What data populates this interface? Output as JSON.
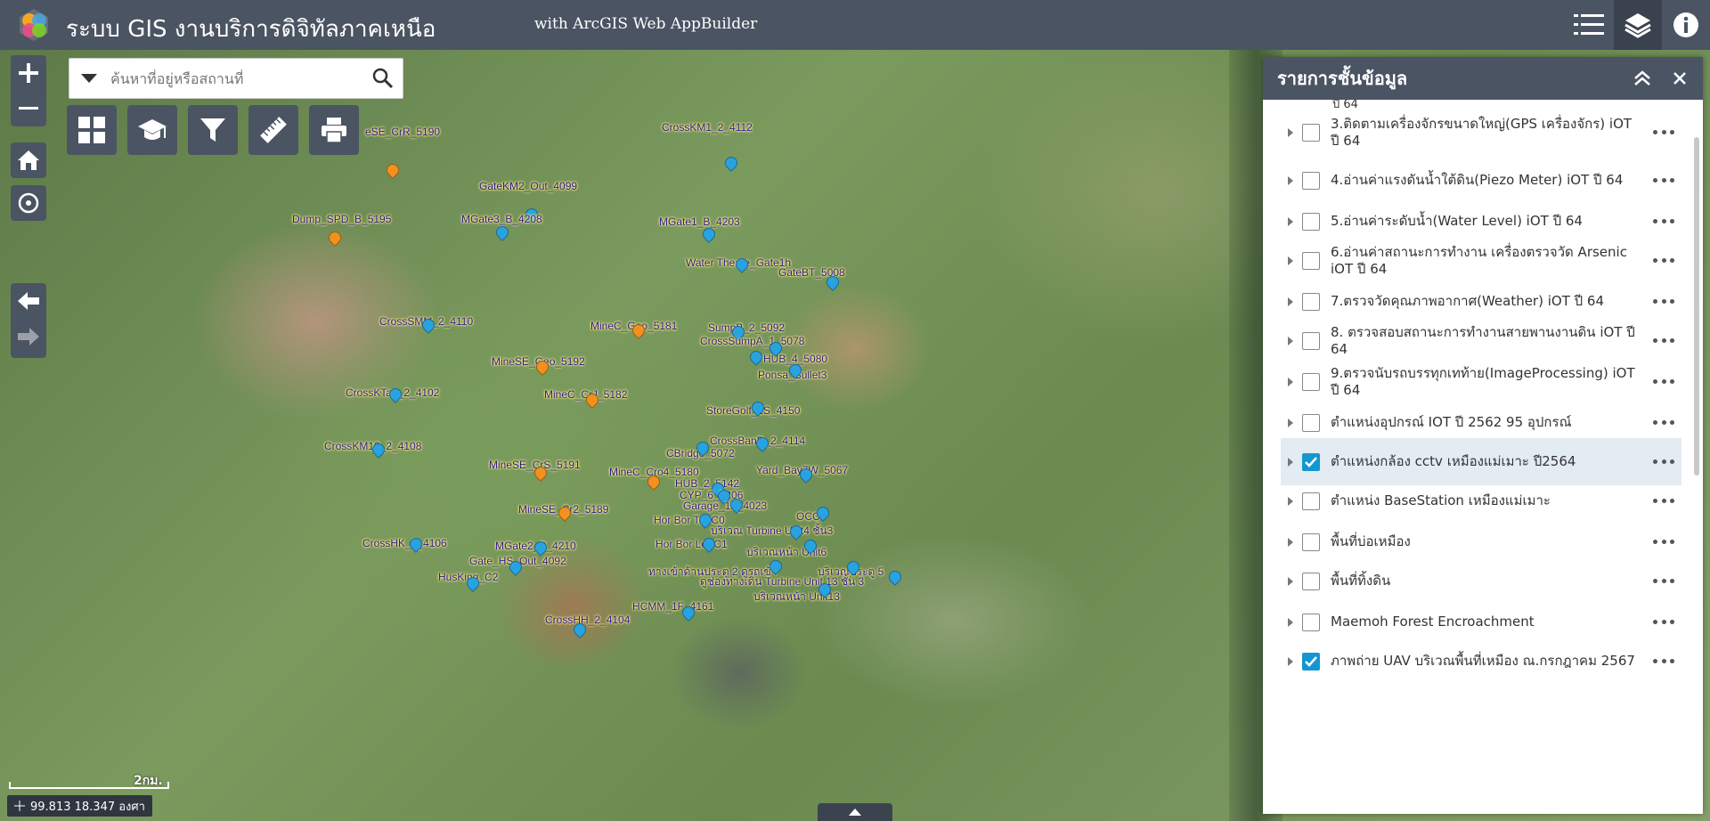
{
  "header": {
    "title": "ระบบ GIS งานบริการดิจิทัลภาคเหนือ",
    "subtitle": "with ArcGIS Web AppBuilder",
    "icons": [
      "legend-icon",
      "layers-icon",
      "info-icon"
    ]
  },
  "search": {
    "placeholder": "ค้นหาที่อยู่หรือสถานที่"
  },
  "toolbar": {
    "widgets": [
      "basemap-gallery-icon",
      "tutorial-icon",
      "filter-icon",
      "measurement-icon",
      "print-icon"
    ]
  },
  "map": {
    "labels": [
      {
        "text": "eSE_CrR_5190",
        "color": "orange"
      },
      {
        "text": "CrossKM1_2_4112",
        "color": "blue"
      },
      {
        "text": "GateKM2_Out_4099",
        "color": "blue"
      },
      {
        "text": "Dump_SPD_B_5195",
        "color": "orange"
      },
      {
        "text": "MGate3_B_4208",
        "color": "blue"
      },
      {
        "text": "MGate1_B_4203",
        "color": "blue"
      },
      {
        "text": "Water Theate_Gate1h",
        "color": "blue"
      },
      {
        "text": "GateBT_5008",
        "color": "blue"
      },
      {
        "text": "CrossSMM_2_4110",
        "color": "blue"
      },
      {
        "text": "MineC_Geo_5181",
        "color": "orange"
      },
      {
        "text": "SumpB_2_5092",
        "color": "blue"
      },
      {
        "text": "CrossSumpA_1_5078",
        "color": "blue"
      },
      {
        "text": "MineSE_Geo_5192",
        "color": "orange"
      },
      {
        "text": "HUB_4_5080",
        "color": "blue"
      },
      {
        "text": "Ponsa_Bullet3",
        "color": "blue"
      },
      {
        "text": "CrossKTao_2_4102",
        "color": "blue"
      },
      {
        "text": "MineC_CrJ_5182",
        "color": "orange"
      },
      {
        "text": "StoreGolf_2S_4150",
        "color": "blue"
      },
      {
        "text": "CrossBanD_2_4114",
        "color": "blue"
      },
      {
        "text": "CrossKM10_2_4108",
        "color": "blue"
      },
      {
        "text": "CBridge_5072",
        "color": "blue"
      },
      {
        "text": "MineSE_CrS_5191",
        "color": "orange"
      },
      {
        "text": "Yard_Bay7W_5067",
        "color": "blue"
      },
      {
        "text": "MineC_Cro4_5180",
        "color": "orange"
      },
      {
        "text": "HUB_2_5142",
        "color": "blue"
      },
      {
        "text": "CYP_6_5206",
        "color": "blue"
      },
      {
        "text": "Garage_1F_4023",
        "color": "blue"
      },
      {
        "text": "MineSE_Cr2_5189",
        "color": "orange"
      },
      {
        "text": "OCC",
        "color": "blue"
      },
      {
        "text": "Hor Bor Tor C0",
        "color": "blue"
      },
      {
        "text": "บริเวณ Turbine Unit4 ชั้น3",
        "color": "blue"
      },
      {
        "text": "CrossHK_2_4106",
        "color": "blue"
      },
      {
        "text": "MGate2_B_4210",
        "color": "blue"
      },
      {
        "text": "Hor Bor Lor C1",
        "color": "blue"
      },
      {
        "text": "บริเวณหน้า Unit6",
        "color": "blue"
      },
      {
        "text": "Gate_HS_Out_4092",
        "color": "blue"
      },
      {
        "text": "ทางเข้าด้านประตู 2 ดูรถเข้า",
        "color": "blue"
      },
      {
        "text": "บริเวณประตู 5",
        "color": "blue"
      },
      {
        "text": "HusKing_C2",
        "color": "blue"
      },
      {
        "text": "ดูช่องทางเดิน Turbine Unit 13 ชั้น 3",
        "color": "blue"
      },
      {
        "text": "บริเวณหน้า Unit13",
        "color": "blue"
      },
      {
        "text": "HCMM_1F_4161",
        "color": "blue"
      },
      {
        "text": "CrossHH_2_4104",
        "color": "blue"
      }
    ],
    "scale_label": "2กม.",
    "coordinates": "99.813 18.347 องศา"
  },
  "layer_panel": {
    "title": "รายการชั้นข้อมูล",
    "partial_top": "ปี 64",
    "layers": [
      {
        "name": "3.ติดตามเครื่องจักรขนาดใหญ่(GPS เครื่องจักร) iOT ปี 64",
        "checked": false,
        "selected": false
      },
      {
        "name": "4.อ่านค่าแรงดันน้ำใต้ดิน(Piezo Meter) iOT ปี 64",
        "checked": false,
        "selected": false
      },
      {
        "name": "5.อ่านค่าระดับน้ำ(Water Level) iOT ปี 64",
        "checked": false,
        "selected": false
      },
      {
        "name": "6.อ่านค่าสถานะการทำงาน เครื่องตรวจวัด Arsenic iOT ปี 64",
        "checked": false,
        "selected": false
      },
      {
        "name": "7.ตรวจวัดคุณภาพอากาศ(Weather) iOT ปี 64",
        "checked": false,
        "selected": false
      },
      {
        "name": "8. ตรวจสอบสถานะการทำงานสายพานงานดิน iOT ปี 64",
        "checked": false,
        "selected": false
      },
      {
        "name": "9.ตรวจนับรถบรรทุกเทท้าย(ImageProcessing) iOT ปี 64",
        "checked": false,
        "selected": false
      },
      {
        "name": "ตำแหน่งอุปกรณ์ IOT ปี 2562 95 อุปกรณ์",
        "checked": false,
        "selected": false
      },
      {
        "name": "ตำแหน่งกล้อง cctv เหมืองแม่เมาะ ปี2564",
        "checked": true,
        "selected": true
      },
      {
        "name": "ตำแหน่ง BaseStation เหมืองแม่เมาะ",
        "checked": false,
        "selected": false
      },
      {
        "name": "พื้นที่บ่อเหมือง",
        "checked": false,
        "selected": false
      },
      {
        "name": "พื้นที่ทิ้งดิน",
        "checked": false,
        "selected": false
      },
      {
        "name": "Maemoh Forest Encroachment",
        "checked": false,
        "selected": false
      },
      {
        "name": "ภาพถ่าย UAV บริเวณพื้นที่เหมือง ณ.กรกฎาคม 2567",
        "checked": true,
        "selected": false
      }
    ]
  }
}
